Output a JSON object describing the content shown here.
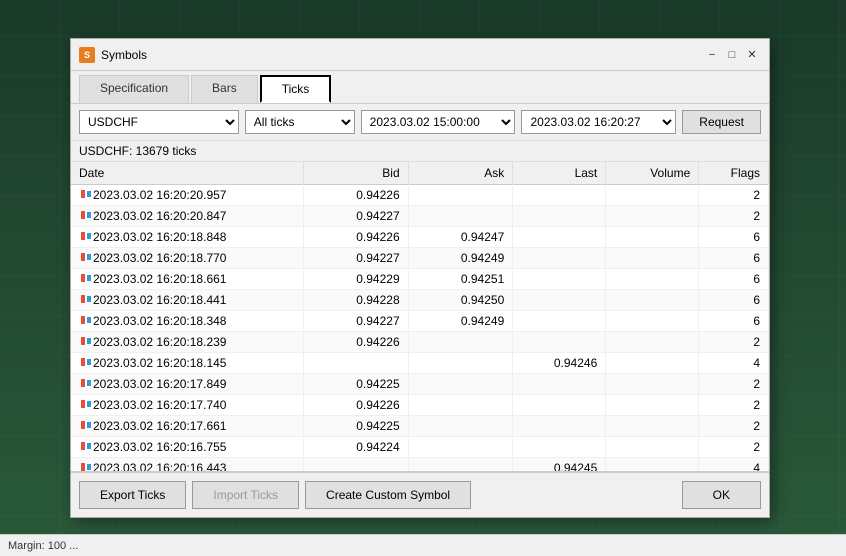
{
  "window": {
    "title": "Symbols",
    "icon": "S"
  },
  "tabs": [
    {
      "id": "specification",
      "label": "Specification",
      "active": false
    },
    {
      "id": "bars",
      "label": "Bars",
      "active": false
    },
    {
      "id": "ticks",
      "label": "Ticks",
      "active": true
    }
  ],
  "filters": {
    "symbol": "USDCHF",
    "type": "All ticks",
    "date_from": "2023.03.02 15:00:00",
    "date_to": "2023.03.02 16:20:27",
    "request_label": "Request"
  },
  "info": {
    "text": "USDCHF: 13679 ticks"
  },
  "table": {
    "headers": [
      "Date",
      "Bid",
      "Ask",
      "Last",
      "Volume",
      "Flags"
    ],
    "rows": [
      {
        "date": "2023.03.02 16:20:20.957",
        "bid": "0.94226",
        "ask": "",
        "last": "",
        "volume": "",
        "flags": "2"
      },
      {
        "date": "2023.03.02 16:20:20.847",
        "bid": "0.94227",
        "ask": "",
        "last": "",
        "volume": "",
        "flags": "2"
      },
      {
        "date": "2023.03.02 16:20:18.848",
        "bid": "0.94226",
        "ask": "0.94247",
        "last": "",
        "volume": "",
        "flags": "6"
      },
      {
        "date": "2023.03.02 16:20:18.770",
        "bid": "0.94227",
        "ask": "0.94249",
        "last": "",
        "volume": "",
        "flags": "6"
      },
      {
        "date": "2023.03.02 16:20:18.661",
        "bid": "0.94229",
        "ask": "0.94251",
        "last": "",
        "volume": "",
        "flags": "6"
      },
      {
        "date": "2023.03.02 16:20:18.441",
        "bid": "0.94228",
        "ask": "0.94250",
        "last": "",
        "volume": "",
        "flags": "6"
      },
      {
        "date": "2023.03.02 16:20:18.348",
        "bid": "0.94227",
        "ask": "0.94249",
        "last": "",
        "volume": "",
        "flags": "6"
      },
      {
        "date": "2023.03.02 16:20:18.239",
        "bid": "0.94226",
        "ask": "",
        "last": "",
        "volume": "",
        "flags": "2"
      },
      {
        "date": "2023.03.02 16:20:18.145",
        "bid": "",
        "ask": "",
        "last": "0.94246",
        "volume": "",
        "flags": "4"
      },
      {
        "date": "2023.03.02 16:20:17.849",
        "bid": "0.94225",
        "ask": "",
        "last": "",
        "volume": "",
        "flags": "2"
      },
      {
        "date": "2023.03.02 16:20:17.740",
        "bid": "0.94226",
        "ask": "",
        "last": "",
        "volume": "",
        "flags": "2"
      },
      {
        "date": "2023.03.02 16:20:17.661",
        "bid": "0.94225",
        "ask": "",
        "last": "",
        "volume": "",
        "flags": "2"
      },
      {
        "date": "2023.03.02 16:20:16.755",
        "bid": "0.94224",
        "ask": "",
        "last": "",
        "volume": "",
        "flags": "2"
      },
      {
        "date": "2023.03.02 16:20:16.443",
        "bid": "",
        "ask": "",
        "last": "0.94245",
        "volume": "",
        "flags": "4"
      }
    ]
  },
  "buttons": {
    "export": "Export Ticks",
    "import": "Import Ticks",
    "create": "Create Custom Symbol",
    "ok": "OK"
  },
  "status": {
    "text": "Margin: 100 ..."
  }
}
